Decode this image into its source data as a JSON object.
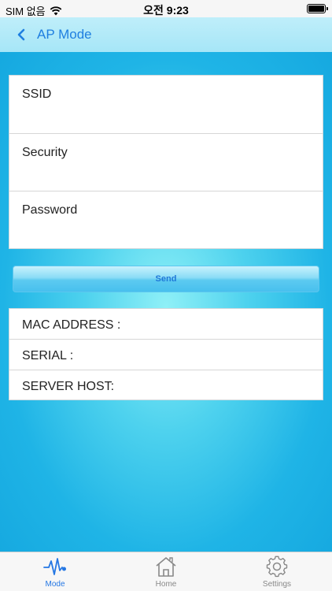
{
  "status_bar": {
    "carrier": "SIM 없음",
    "time": "오전 9:23"
  },
  "nav": {
    "back_icon": "chevron-left-icon",
    "title": "AP Mode"
  },
  "form": {
    "fields": [
      {
        "label": "SSID",
        "value": ""
      },
      {
        "label": "Security",
        "value": ""
      },
      {
        "label": "Password",
        "value": ""
      }
    ]
  },
  "send_label": "Send",
  "info": {
    "mac_label": "MAC ADDRESS :",
    "serial_label": "SERIAL :",
    "server_label": "SERVER HOST:"
  },
  "tabs": [
    {
      "label": "Mode",
      "icon": "pulse-icon",
      "active": true
    },
    {
      "label": "Home",
      "icon": "home-icon",
      "active": false
    },
    {
      "label": "Settings",
      "icon": "gear-icon",
      "active": false
    }
  ],
  "colors": {
    "accent": "#2577e3",
    "background": "#1fb4e6",
    "nav_background": "#bfeefa"
  }
}
